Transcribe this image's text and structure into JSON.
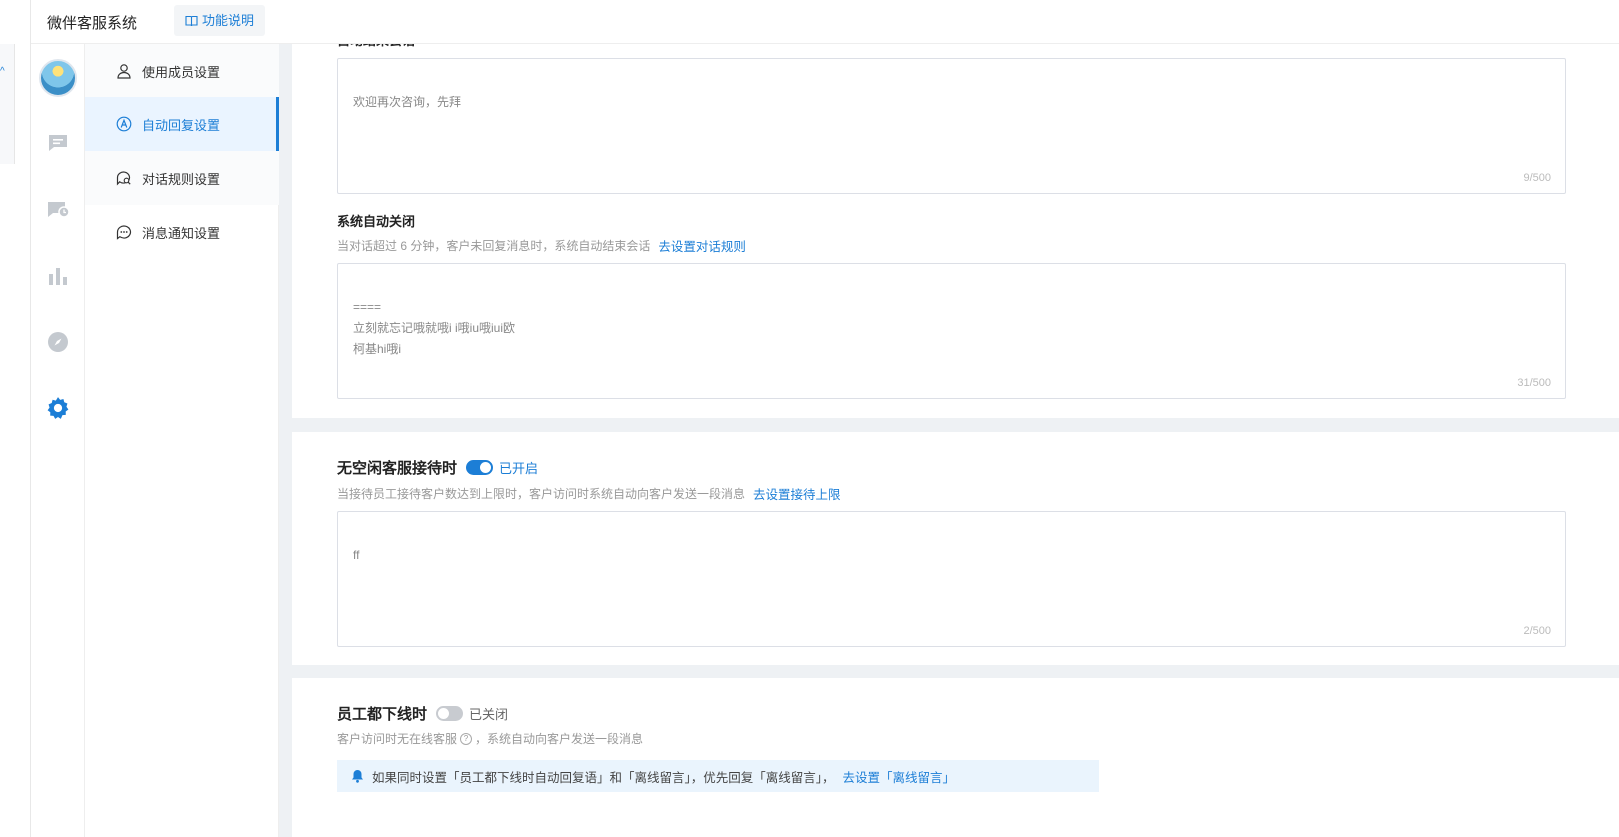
{
  "app": {
    "brand": "微伴客服系统",
    "doc_button": "功能说明"
  },
  "submenu": {
    "items": [
      {
        "label": "使用成员设置",
        "icon": "user-icon"
      },
      {
        "label": "自动回复设置",
        "icon": "auto-reply-icon"
      },
      {
        "label": "对话规则设置",
        "icon": "chat-rule-icon"
      },
      {
        "label": "消息通知设置",
        "icon": "message-notify-icon"
      }
    ]
  },
  "rail": {
    "icons": [
      "avatar",
      "chat-icon",
      "ticket-icon",
      "stats-icon",
      "compass-icon",
      "settings-icon"
    ]
  },
  "section_first": {
    "textbox_value": "欢迎再次咨询，先拜",
    "counter": "9/500"
  },
  "section_auto_close": {
    "label": "系统自动关闭",
    "desc": "当对话超过 6 分钟，客户未回复消息时，系统自动结束会话",
    "link": "去设置对话规则",
    "textbox_value": "====\n立刻就忘记哦就哦i i哦iu哦iui欧\n柯基hi哦i",
    "counter": "31/500"
  },
  "section_busy": {
    "title": "无空闲客服接待时",
    "state": "已开启",
    "desc": "当接待员工接待客户数达到上限时，客户访问时系统自动向客户发送一段消息",
    "link": "去设置接待上限",
    "textbox_value": "ff",
    "counter": "2/500"
  },
  "section_offline": {
    "title": "员工都下线时",
    "state": "已关闭",
    "desc_before": "客户访问时无在线客服",
    "desc_after": "，系统自动向客户发送一段消息",
    "notice_text": "如果同时设置「员工都下线时自动回复语」和「离线留言」，优先回复「离线留言」，",
    "notice_link": "去设置「离线留言」"
  },
  "colors": {
    "accent": "#1c7ed6",
    "background": "#eef1f4"
  }
}
